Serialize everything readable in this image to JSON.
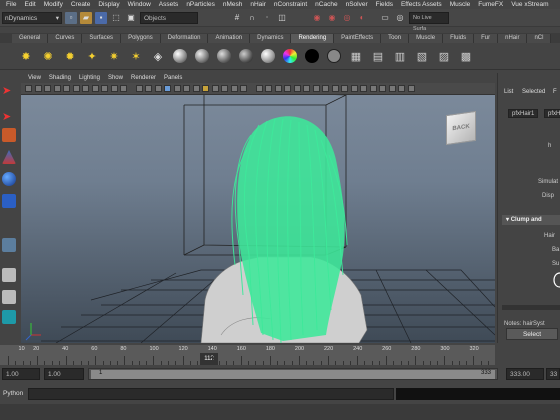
{
  "menubar": {
    "items": [
      "File",
      "Edit",
      "Modify",
      "Create",
      "Display",
      "Window",
      "Assets",
      "nParticles",
      "nMesh",
      "nHair",
      "nConstraint",
      "nCache",
      "nSolver",
      "Fields",
      "Effects Assets",
      "Muscle",
      "FumeFX",
      "Vue xStream"
    ]
  },
  "statusline": {
    "mode": "nDynamics",
    "selection_mode_label": "Objects",
    "live_surface_label": "No Live Surfa"
  },
  "shelf": {
    "tabs": [
      "General",
      "Curves",
      "Surfaces",
      "Polygons",
      "Deformation",
      "Animation",
      "Dynamics",
      "Rendering",
      "PaintEffects",
      "Toon",
      "Muscle",
      "Fluids",
      "Fur",
      "nHair",
      "nCl"
    ],
    "active_tab": "Rendering"
  },
  "viewport": {
    "menu": [
      "View",
      "Shading",
      "Lighting",
      "Show",
      "Renderer",
      "Panels"
    ],
    "viewcube_label": "BACK",
    "hair_color": "#3ee89a"
  },
  "attribute_editor": {
    "tabs": [
      "List",
      "Selected",
      "F"
    ],
    "node_name": "pfxHair1",
    "node_name_2": "pfxH",
    "label_h": "h",
    "label_simulation": "Simulat",
    "label_display": "Disp",
    "section_title": "Clump and",
    "label_hair": "Hair",
    "label_ba": "Ba",
    "label_su": "Su",
    "notes_label": "Notes: hairSyst",
    "select_button": "Select",
    "close_button": "Close"
  },
  "timeslider": {
    "ticks": [
      "10",
      "20",
      "40",
      "60",
      "80",
      "100",
      "120",
      "140",
      "160",
      "180",
      "200",
      "220",
      "240",
      "260",
      "280",
      "300",
      "320"
    ],
    "current_frame": "112"
  },
  "rangeslider": {
    "start_time": "1.00",
    "playback_start": "1.00",
    "range_start": "1",
    "range_end": "333",
    "playback_end": "333.00",
    "end_time": "33"
  },
  "commandline": {
    "language": "Python"
  }
}
